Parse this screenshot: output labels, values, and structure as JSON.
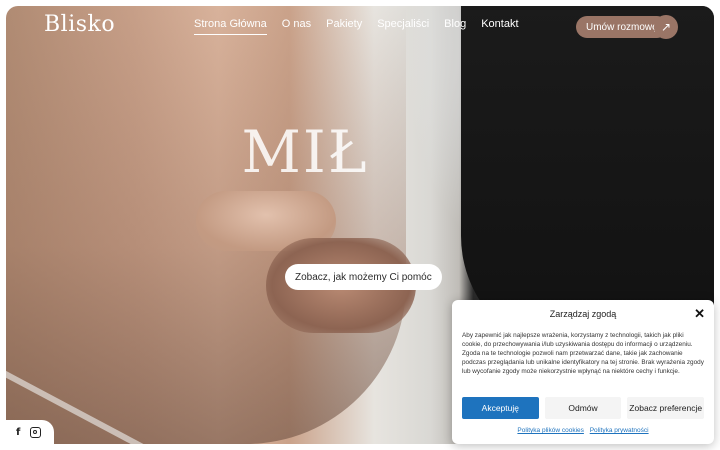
{
  "brand": {
    "logo_text": "Blisko"
  },
  "nav": {
    "items": [
      {
        "label": "Strona Główna",
        "active": true
      },
      {
        "label": "O nas",
        "active": false
      },
      {
        "label": "Pakiety",
        "active": false
      },
      {
        "label": "Specjaliści",
        "active": false
      },
      {
        "label": "Blog",
        "active": false
      },
      {
        "label": "Kontakt",
        "active": false
      }
    ]
  },
  "header": {
    "cta_label": "Umów rozmowę",
    "cta_icon": "arrow-up-right-icon"
  },
  "hero": {
    "watermark_text": "MIŁ",
    "button_label": "Zobacz, jak możemy Ci pomóc"
  },
  "social": {
    "icons": [
      "facebook-icon",
      "instagram-icon"
    ]
  },
  "consent": {
    "title": "Zarządzaj zgodą",
    "body": "Aby zapewnić jak najlepsze wrażenia, korzystamy z technologii, takich jak pliki cookie, do przechowywania i/lub uzyskiwania dostępu do informacji o urządzeniu. Zgoda na te technologie pozwoli nam przetwarzać dane, takie jak zachowanie podczas przeglądania lub unikalne identyfikatory na tej stronie. Brak wyrażenia zgody lub wycofanie zgody może niekorzystnie wpłynąć na niektóre cechy i funkcje.",
    "accept_label": "Akceptuję",
    "deny_label": "Odmów",
    "preferences_label": "Zobacz preferencje",
    "cookie_policy_label": "Polityka plików cookies",
    "privacy_policy_label": "Polityka prywatności"
  },
  "colors": {
    "accent": "#9a7566",
    "consent_primary": "#1e73be"
  }
}
